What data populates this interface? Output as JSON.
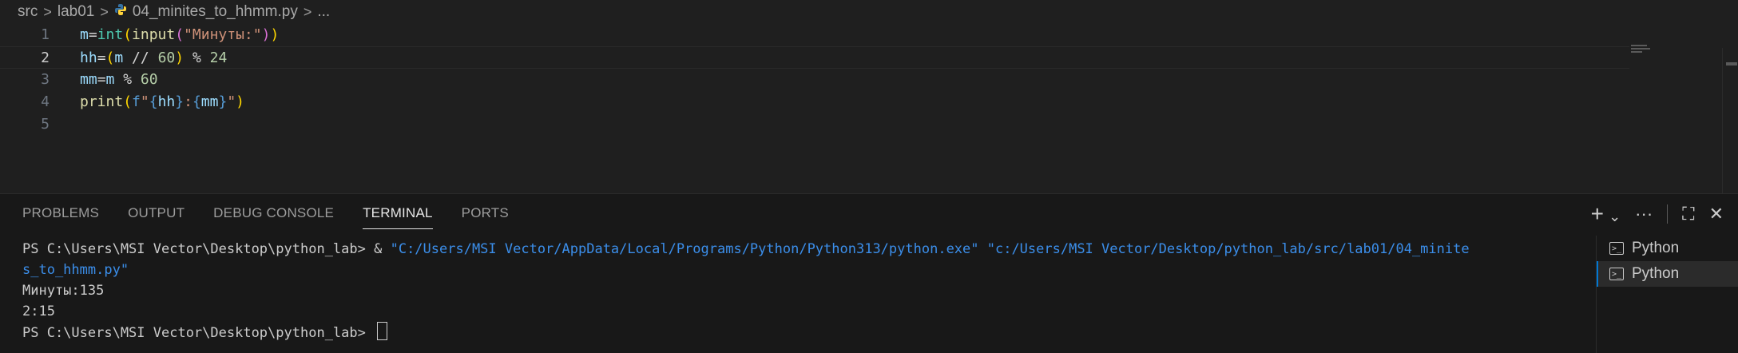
{
  "breadcrumb": {
    "parts": [
      "src",
      "lab01",
      "04_minites_to_hhmm.py",
      "..."
    ],
    "separator": ">"
  },
  "editor": {
    "lines": [
      {
        "number": "1"
      },
      {
        "number": "2"
      },
      {
        "number": "3"
      },
      {
        "number": "4"
      },
      {
        "number": "5"
      }
    ],
    "active_line": 2
  },
  "panel": {
    "tabs": [
      "PROBLEMS",
      "OUTPUT",
      "DEBUG CONSOLE",
      "TERMINAL",
      "PORTS"
    ],
    "active_tab": "TERMINAL",
    "actions": {
      "new_terminal": "+",
      "dropdown": "⌄",
      "more": "···",
      "maximize": "⛶",
      "close": "✕"
    }
  },
  "terminal": {
    "prompt": "PS C:\\Users\\MSI Vector\\Desktop\\python_lab> ",
    "command_op": "& ",
    "command_line1": "\"C:/Users/MSI Vector/AppData/Local/Programs/Python/Python313/python.exe\" \"c:/Users/MSI Vector/Desktop/python_lab/src/lab01/04_minite",
    "command_line2": "s_to_hhmm.py\"",
    "output1": "Минуты:135",
    "output2": "2:15",
    "prompt2": "PS C:\\Users\\MSI Vector\\Desktop\\python_lab> "
  },
  "terminal_list": {
    "items": [
      {
        "label": "Python",
        "icon": "terminal-icon"
      },
      {
        "label": "Python",
        "icon": "terminal-icon"
      }
    ],
    "selected_index": 1
  },
  "colors": {
    "background": "#1f1f1f",
    "panel_background": "#181818",
    "accent": "#0078d4",
    "terminal_path": "#3b8eea"
  }
}
